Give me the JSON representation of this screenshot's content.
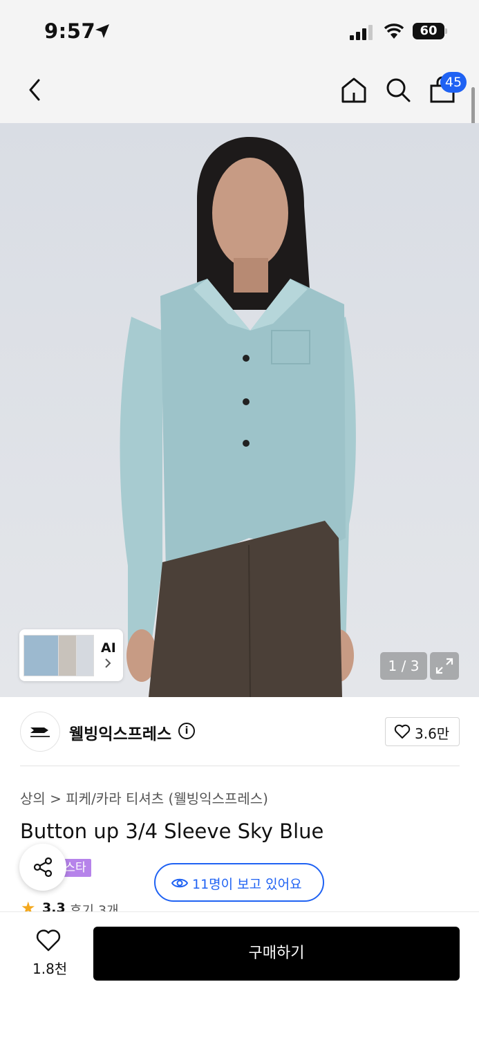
{
  "status_bar": {
    "time": "9:57",
    "battery": "60"
  },
  "nav": {
    "cart_count": "45"
  },
  "image": {
    "ai_label": "AI",
    "pager": "1 / 3"
  },
  "store": {
    "name": "웰빙익스프레스",
    "like_count": "3.6만"
  },
  "product": {
    "breadcrumb": "상의 > 피케/카라 티셔츠 (웰빙익스프레스)",
    "title": "Button up 3/4 Sleeve Sky Blue",
    "badge": "스타",
    "viewers": "11명이 보고 있어요",
    "rating": "3.3",
    "reviews": "후기 3개"
  },
  "bottom": {
    "wish_count": "1.8천",
    "buy_label": "구매하기"
  },
  "colors": {
    "accent": "#1f62f3",
    "badge": "#b683ea",
    "shirt": "#9dc3c9",
    "pants": "#4b4038"
  },
  "icons": [
    "location-arrow-icon",
    "signal-icon",
    "wifi-icon",
    "battery-icon",
    "back-icon",
    "home-icon",
    "search-icon",
    "cart-icon",
    "chevron-right-icon",
    "expand-icon",
    "info-icon",
    "heart-icon",
    "share-icon",
    "eye-icon",
    "star-icon"
  ]
}
